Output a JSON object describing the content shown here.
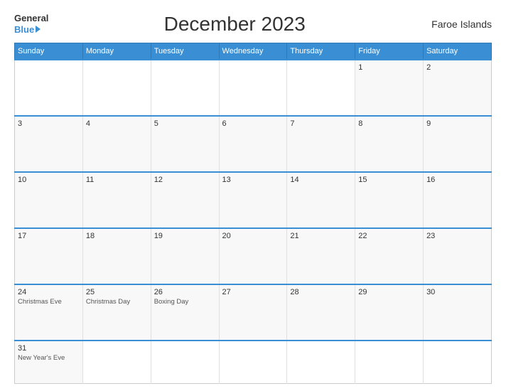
{
  "header": {
    "logo_general": "General",
    "logo_blue": "Blue",
    "title": "December 2023",
    "region": "Faroe Islands"
  },
  "weekdays": [
    "Sunday",
    "Monday",
    "Tuesday",
    "Wednesday",
    "Thursday",
    "Friday",
    "Saturday"
  ],
  "weeks": [
    [
      {
        "day": "",
        "events": []
      },
      {
        "day": "",
        "events": []
      },
      {
        "day": "",
        "events": []
      },
      {
        "day": "",
        "events": []
      },
      {
        "day": "",
        "events": []
      },
      {
        "day": "1",
        "events": []
      },
      {
        "day": "2",
        "events": []
      }
    ],
    [
      {
        "day": "3",
        "events": []
      },
      {
        "day": "4",
        "events": []
      },
      {
        "day": "5",
        "events": []
      },
      {
        "day": "6",
        "events": []
      },
      {
        "day": "7",
        "events": []
      },
      {
        "day": "8",
        "events": []
      },
      {
        "day": "9",
        "events": []
      }
    ],
    [
      {
        "day": "10",
        "events": []
      },
      {
        "day": "11",
        "events": []
      },
      {
        "day": "12",
        "events": []
      },
      {
        "day": "13",
        "events": []
      },
      {
        "day": "14",
        "events": []
      },
      {
        "day": "15",
        "events": []
      },
      {
        "day": "16",
        "events": []
      }
    ],
    [
      {
        "day": "17",
        "events": []
      },
      {
        "day": "18",
        "events": []
      },
      {
        "day": "19",
        "events": []
      },
      {
        "day": "20",
        "events": []
      },
      {
        "day": "21",
        "events": []
      },
      {
        "day": "22",
        "events": []
      },
      {
        "day": "23",
        "events": []
      }
    ],
    [
      {
        "day": "24",
        "events": [
          "Christmas Eve"
        ]
      },
      {
        "day": "25",
        "events": [
          "Christmas Day"
        ]
      },
      {
        "day": "26",
        "events": [
          "Boxing Day"
        ]
      },
      {
        "day": "27",
        "events": []
      },
      {
        "day": "28",
        "events": []
      },
      {
        "day": "29",
        "events": []
      },
      {
        "day": "30",
        "events": []
      }
    ],
    [
      {
        "day": "31",
        "events": [
          "New Year's Eve"
        ]
      },
      {
        "day": "",
        "events": []
      },
      {
        "day": "",
        "events": []
      },
      {
        "day": "",
        "events": []
      },
      {
        "day": "",
        "events": []
      },
      {
        "day": "",
        "events": []
      },
      {
        "day": "",
        "events": []
      }
    ]
  ]
}
